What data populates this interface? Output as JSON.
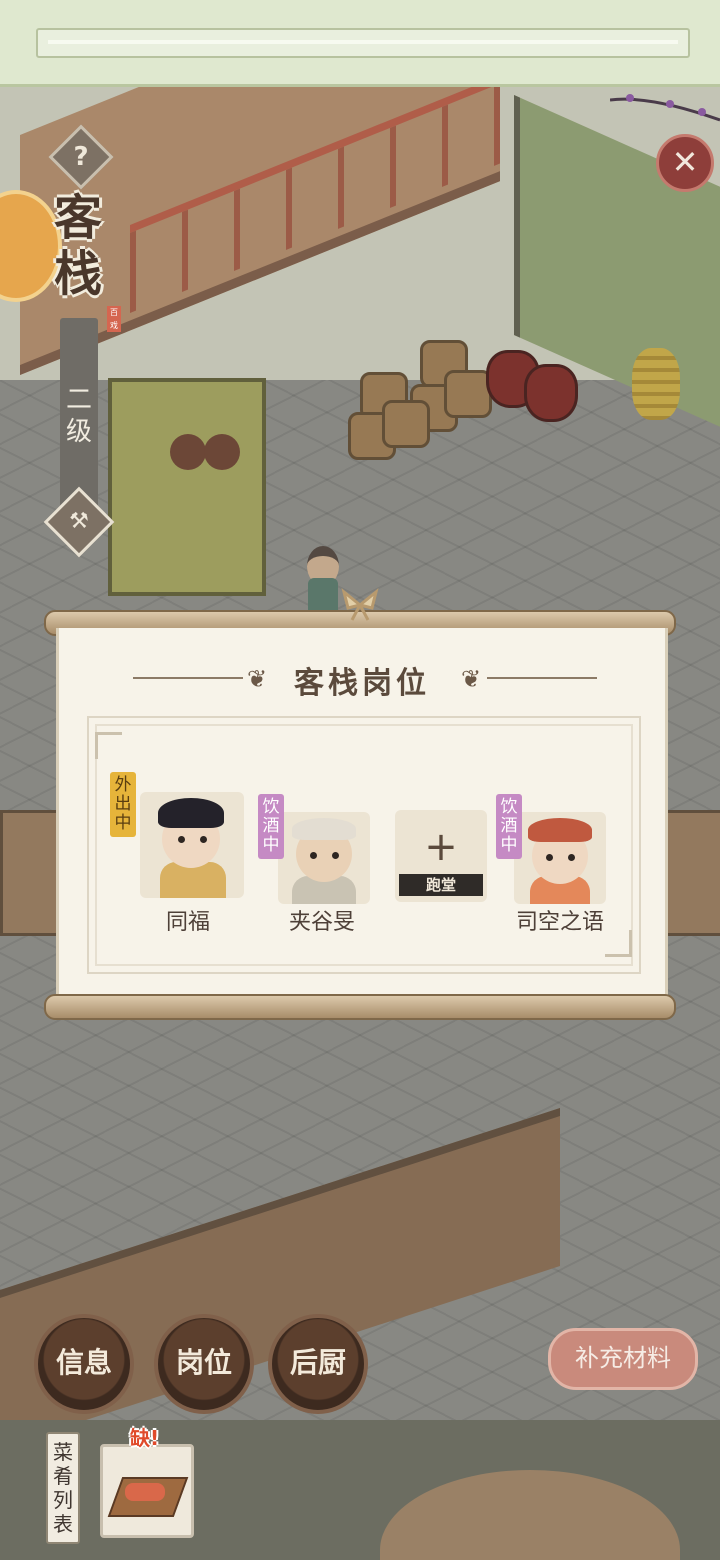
{
  "left_panel": {
    "title": "客栈",
    "seal": "百戏",
    "level": "二级",
    "help_icon": "question-mark-icon",
    "build_icon": "hammer-icon"
  },
  "close_icon": "close-icon",
  "dialog": {
    "title": "客栈岗位",
    "slots": [
      {
        "name": "同福",
        "status": "外出中",
        "status_color": "#e6b43a"
      },
      {
        "name": "夹谷旻",
        "status": "饮酒中",
        "status_color": "#c58ac4"
      },
      {
        "name": "",
        "empty": true,
        "role": "跑堂",
        "add_icon": "plus-icon"
      },
      {
        "name": "司空之语",
        "status": "饮酒中",
        "status_color": "#c58ac4"
      }
    ]
  },
  "bottom": {
    "buttons": [
      "信息",
      "岗位",
      "后厨"
    ],
    "supply_button": "补充材料",
    "menu_tab": "菜肴列表",
    "lack_label": "缺!"
  }
}
